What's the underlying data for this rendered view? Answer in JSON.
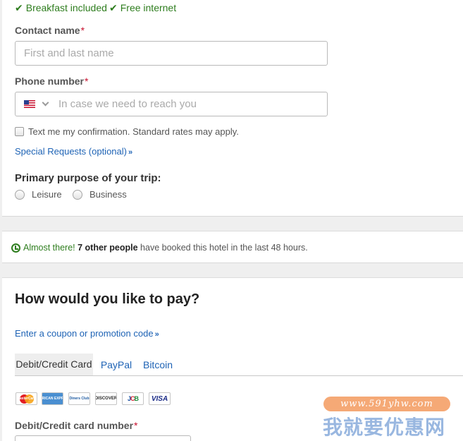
{
  "amenities": [
    "Breakfast included",
    "Free internet"
  ],
  "contact": {
    "label": "Contact name",
    "required_mark": "*",
    "placeholder": "First and last name"
  },
  "phone": {
    "label": "Phone number",
    "required_mark": "*",
    "country_icon": "us-flag-icon",
    "placeholder": "In case we need to reach you"
  },
  "sms_optin": {
    "checked": false,
    "text": "Text me my confirmation. Standard rates may apply."
  },
  "special_requests": {
    "label": "Special Requests (optional)",
    "chevron": "»"
  },
  "trip_purpose": {
    "question": "Primary purpose of your trip:",
    "options": [
      "Leisure",
      "Business"
    ]
  },
  "urgency": {
    "lead": "Almost there!",
    "count_text": "7 other people",
    "rest": "have booked this hotel in the last 48 hours."
  },
  "payment": {
    "heading": "How would you like to pay?",
    "coupon_link": "Enter a coupon or promotion code",
    "coupon_chevron": "»",
    "tabs": [
      {
        "label": "Debit/Credit Card",
        "active": true
      },
      {
        "label": "PayPal",
        "active": false
      },
      {
        "label": "Bitcoin",
        "active": false
      }
    ],
    "card_logos": [
      {
        "icon": "mastercard-icon",
        "text": "MasterCard"
      },
      {
        "icon": "amex-icon",
        "text": "AMERICAN EXPRESS"
      },
      {
        "icon": "diners-club-icon",
        "text": "Diners Club"
      },
      {
        "icon": "discover-icon",
        "text": "DISCOVER"
      },
      {
        "icon": "jcb-icon",
        "text": "JCB"
      },
      {
        "icon": "visa-icon",
        "text": "VISA"
      }
    ],
    "card_number_label": "Debit/Credit card number",
    "card_number_required": "*"
  },
  "watermark": {
    "url": "www.591yhw.com",
    "text": "我就要优惠网"
  },
  "colors": {
    "accent_green": "#2e7d1e",
    "link_blue": "#1e63b5",
    "required_red": "#c8102e"
  }
}
